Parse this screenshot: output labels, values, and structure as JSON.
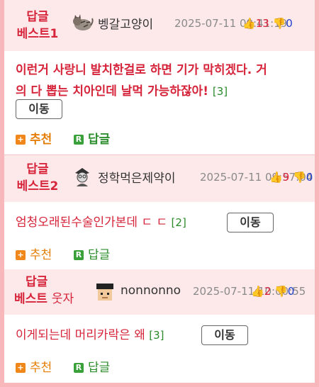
{
  "posts": [
    {
      "badge_line1": "답글",
      "badge_line2": "베스트1",
      "badge_extra": "",
      "nickname": "벵갈고양이",
      "date": "2025-07-11 09:41:19",
      "up": "13",
      "down": "0",
      "text_line1": "이런거 사랑니 발치한걸로 하면 기가 막히겠다. 거",
      "text_line2": "의 다 뽑는 치아인데 날먹 가능하잖아!",
      "reply_count": "[3]",
      "move_label": "이동",
      "recommend_label": "추천",
      "reply_label": "답글"
    },
    {
      "badge_line1": "답글",
      "badge_line2": "베스트2",
      "badge_extra": "",
      "nickname": "정학먹은제약이",
      "date": "2025-07-11 09:57:04",
      "up": "9",
      "down": "0",
      "text_line1": "엄청오래된수술인가본데 ㄷ ㄷ",
      "reply_count": "[2]",
      "move_label": "이동",
      "recommend_label": "추천",
      "reply_label": "답글"
    },
    {
      "badge_line1": "답글",
      "badge_line2": "베스트",
      "badge_extra": "웃자",
      "nickname": "nonnonno",
      "date": "2025-07-11 10:00:55",
      "up": "2",
      "down": "0",
      "text_line1": "이게되는데 머리카락은 왜",
      "reply_count": "[3]",
      "move_label": "이동",
      "recommend_label": "추천",
      "reply_label": "답글"
    }
  ],
  "icons": {
    "thumb_up": "thumbs-up-icon",
    "thumb_down": "thumbs-down-icon",
    "recommend": "plus-icon",
    "reply": "reply-r-icon"
  },
  "colors": {
    "accent_red": "#d6243a",
    "header_bg": "#fde8ea",
    "frame_border": "#f8b7bb",
    "recommend_orange": "#e57e06",
    "reply_green": "#2e8f2e",
    "downvote_blue": "#1e3fcf"
  }
}
